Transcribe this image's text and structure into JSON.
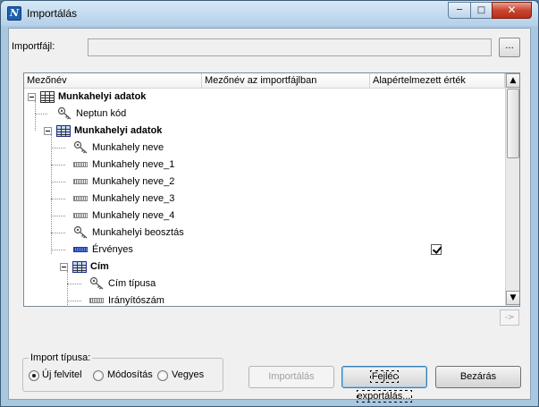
{
  "window": {
    "title": "Importálás",
    "app_icon": "N"
  },
  "file": {
    "label": "Importfájl:",
    "value": "",
    "browse_label": "..."
  },
  "grid": {
    "columns": [
      "Mezőnév",
      "Mezőnév az importfájlban",
      "Alapértelmezett érték"
    ],
    "rows": [
      {
        "label": "Munkahelyi adatok",
        "type": "table",
        "bold": true,
        "expanded": true
      },
      {
        "label": "Neptun kód",
        "type": "key",
        "bold": false
      },
      {
        "label": "Munkahelyi adatok",
        "type": "table-blue",
        "bold": true,
        "expanded": true
      },
      {
        "label": "Munkahely neve",
        "type": "key",
        "bold": false
      },
      {
        "label": "Munkahely neve_1",
        "type": "field",
        "bold": false
      },
      {
        "label": "Munkahely neve_2",
        "type": "field",
        "bold": false
      },
      {
        "label": "Munkahely neve_3",
        "type": "field",
        "bold": false
      },
      {
        "label": "Munkahely neve_4",
        "type": "field",
        "bold": false
      },
      {
        "label": "Munkahelyi beosztás",
        "type": "key",
        "bold": false
      },
      {
        "label": "Érvényes",
        "type": "field-blue",
        "bold": false,
        "default_checked": true
      },
      {
        "label": "Cím",
        "type": "table-blue",
        "bold": true,
        "expanded": true
      },
      {
        "label": "Cím típusa",
        "type": "key",
        "bold": false
      },
      {
        "label": "Irányítószám",
        "type": "field",
        "bold": false
      }
    ]
  },
  "arrow_button_label": "->",
  "import_type": {
    "legend": "Import típusa:",
    "options": [
      "Új felvitel",
      "Módosítás",
      "Vegyes"
    ],
    "selected": "Új felvitel"
  },
  "buttons": {
    "import": "Importálás",
    "export_header": "Fejléc exportálás...",
    "close": "Bezárás"
  },
  "icons": {
    "minimize": "minimize-icon",
    "maximize": "maximize-icon",
    "close": "close-icon",
    "table": "table-icon",
    "key": "key-icon",
    "field": "field-icon"
  }
}
